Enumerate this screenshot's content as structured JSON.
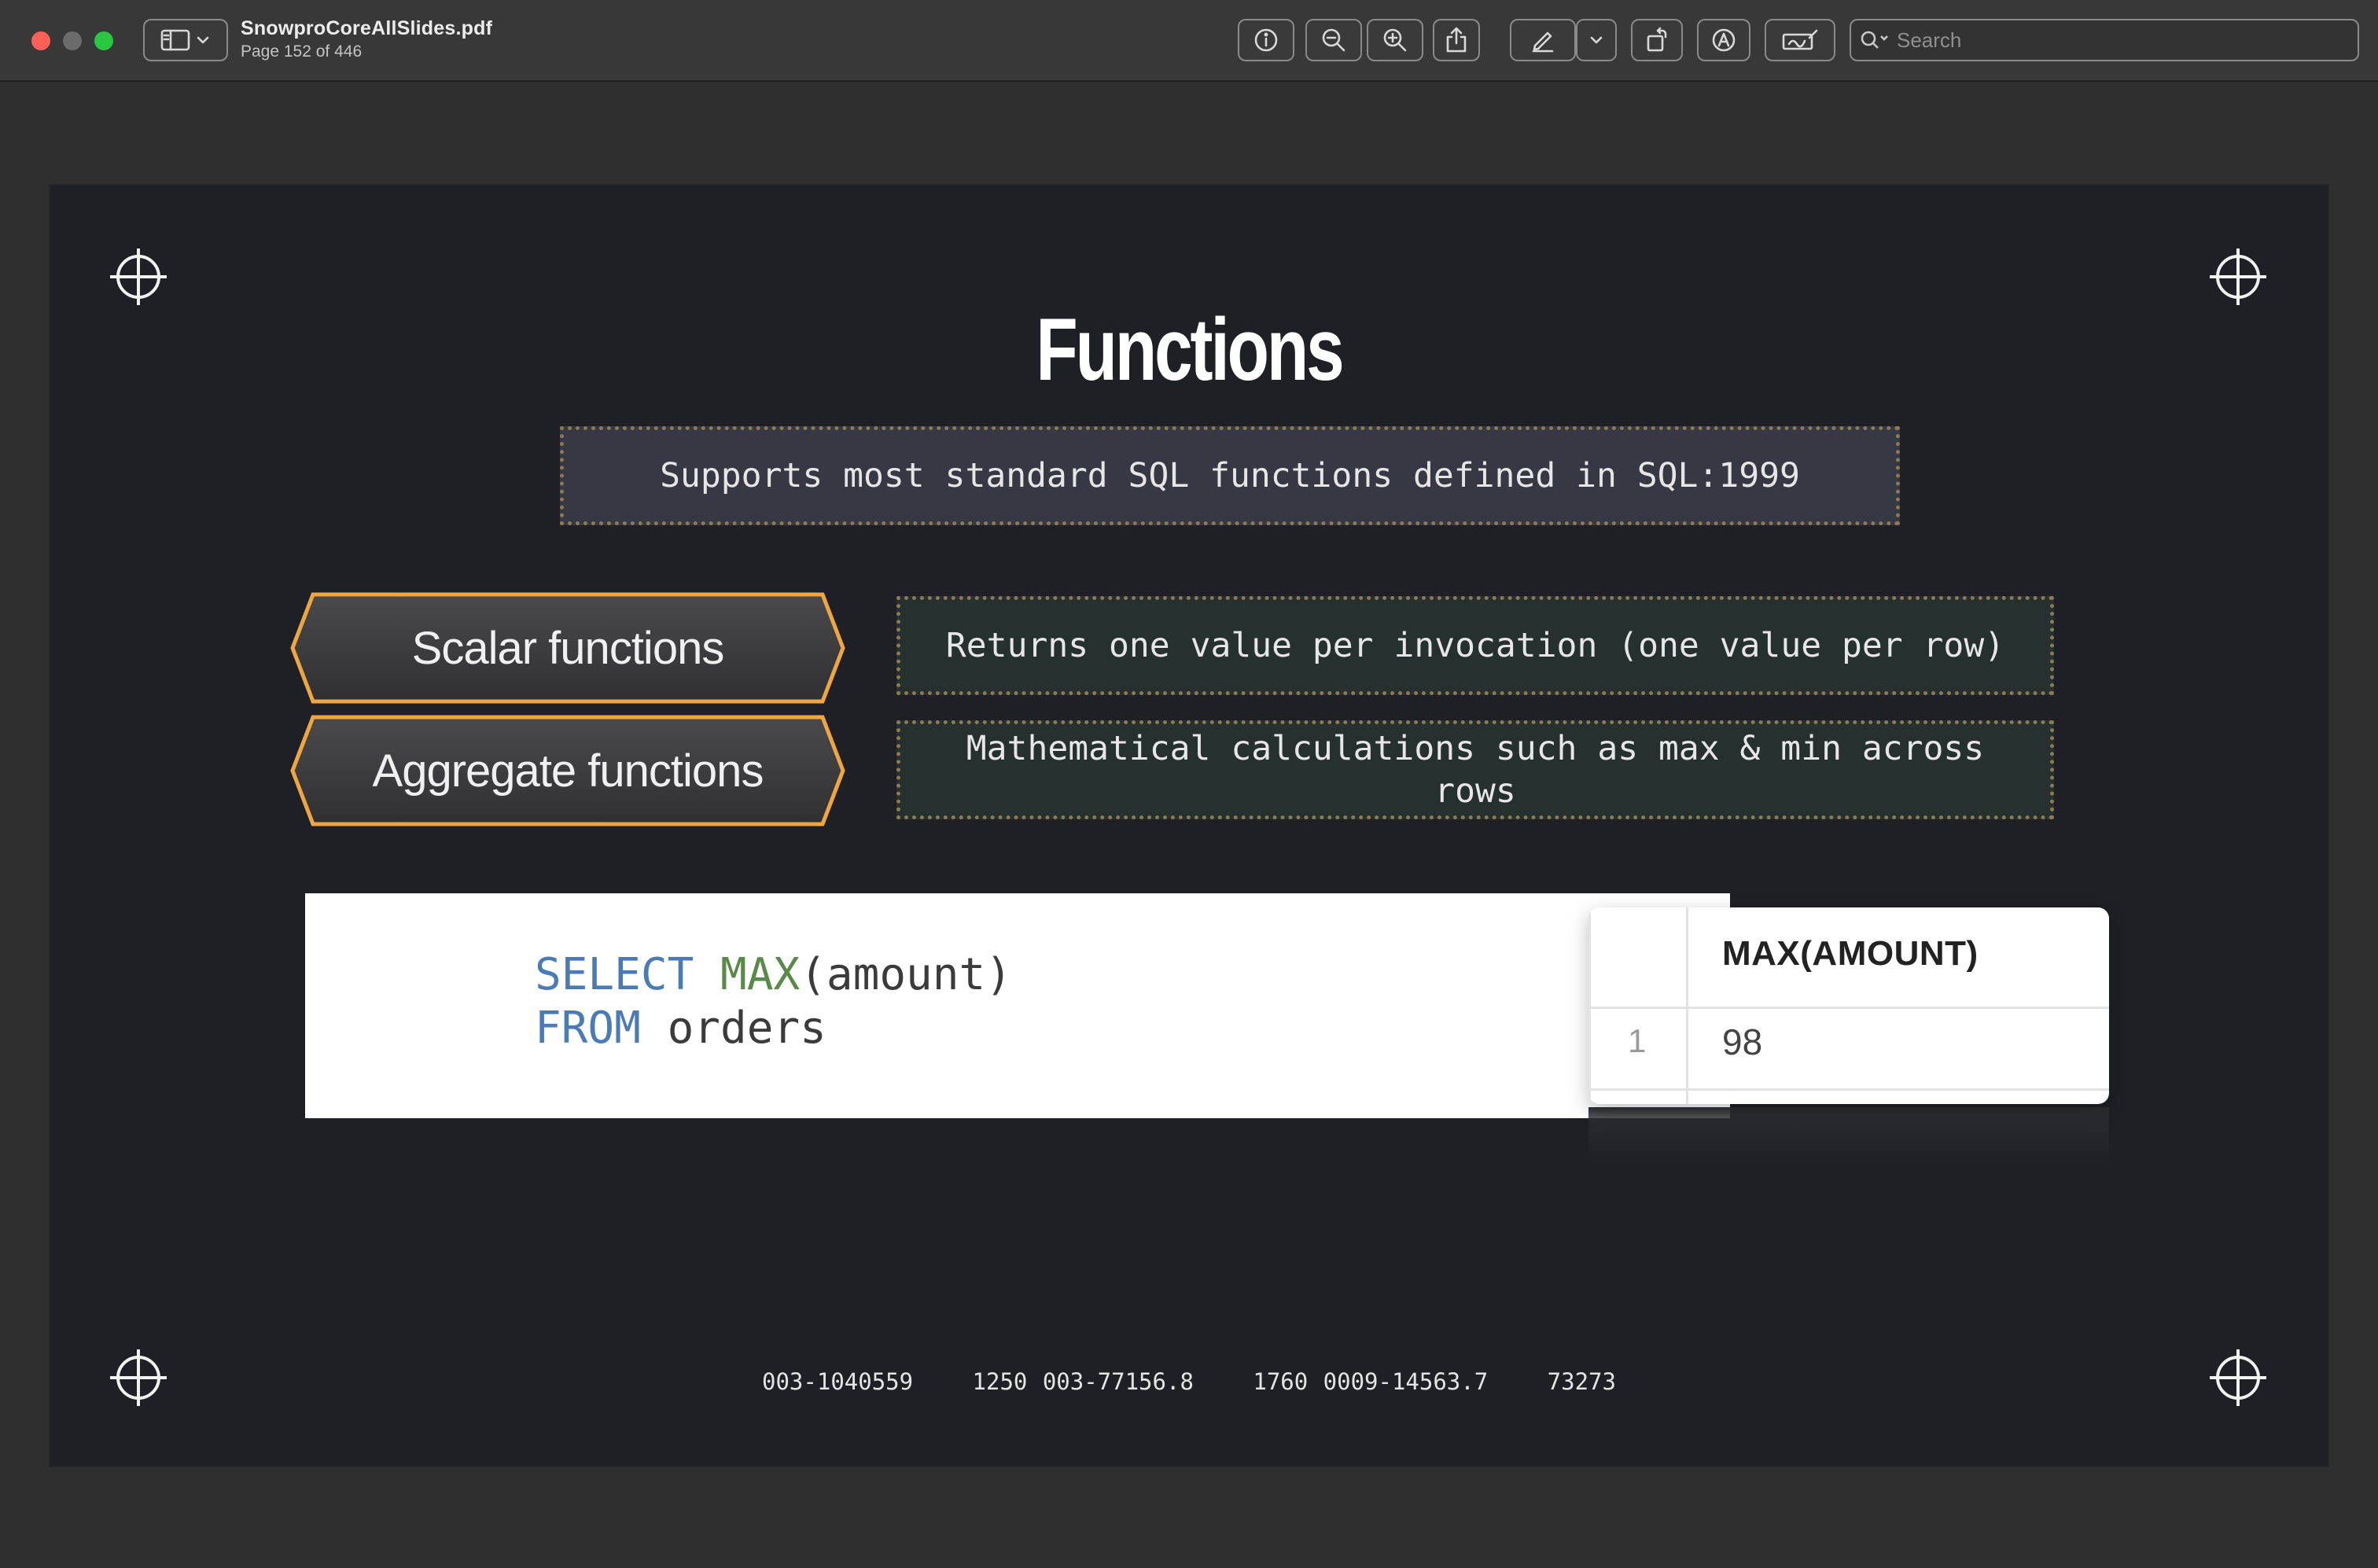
{
  "window": {
    "doc_title": "SnowproCoreAllSlides.pdf",
    "page_label": "Page 152 of 446",
    "search_placeholder": "Search"
  },
  "toolbar": {
    "icons": [
      "sidebar-icon",
      "chevron-down-icon",
      "info-icon",
      "zoom-out-icon",
      "zoom-in-icon",
      "share-icon",
      "markup-pen-icon",
      "chevron-down-icon",
      "rotate-icon",
      "markup-circle-icon",
      "signature-icon",
      "search-icon"
    ]
  },
  "slide": {
    "title": "Functions",
    "subtitle": "Supports most standard SQL functions defined in SQL:1999",
    "categories": [
      {
        "label": "Scalar functions",
        "description": "Returns one value per invocation (one value per row)"
      },
      {
        "label": "Aggregate functions",
        "description": "Mathematical calculations such as max & min across rows"
      }
    ],
    "code": {
      "line1_kw": "SELECT",
      "line1_fn": "MAX",
      "line1_rest": "(amount)",
      "line2_kw": "FROM",
      "line2_rest": " orders"
    },
    "result_table": {
      "header": "MAX(AMOUNT)",
      "rows": [
        {
          "row_number": "1",
          "value": "98"
        }
      ]
    },
    "footer_codes": [
      "003-1040559",
      "1250 003-77156.8",
      "1760 0009-14563.7",
      "73273"
    ],
    "colors": {
      "hex_border": "#f0a640",
      "dotted_border": "#8b7a52",
      "keyword": "#4a7bb7",
      "function": "#5a8a4a"
    }
  }
}
